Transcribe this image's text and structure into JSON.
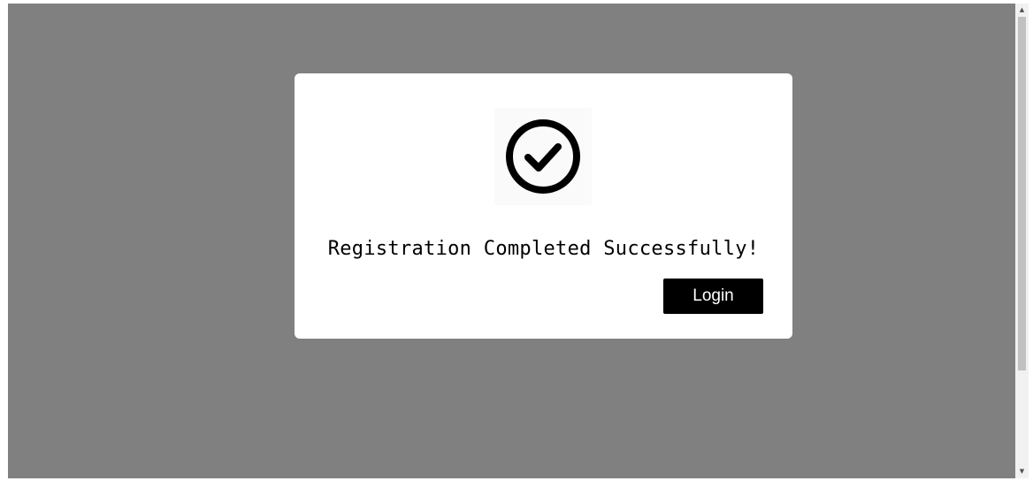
{
  "modal": {
    "icon": "check-circle-icon",
    "message": "Registration Completed Successfully!",
    "login_label": "Login"
  },
  "colors": {
    "overlay": "#808080",
    "modal_background": "#ffffff",
    "button_background": "#000000",
    "button_text": "#ffffff"
  }
}
